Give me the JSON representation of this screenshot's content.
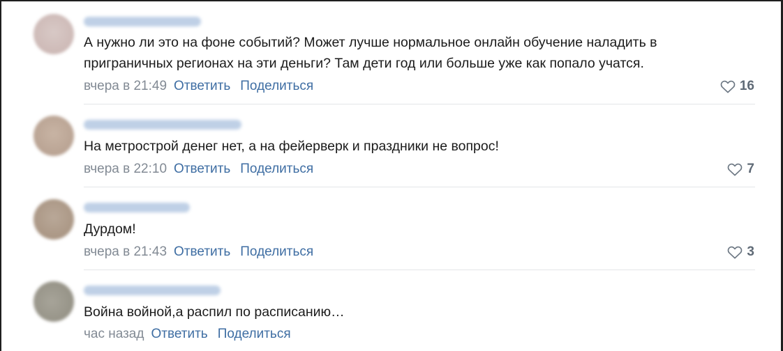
{
  "comments": [
    {
      "text": "А нужно ли это на фоне событий? Может лучше нормальное онлайн обучение наладить в приграничных регионах на эти деньги? Там дети год или больше уже как попало учатся.",
      "time": "вчера в 21:49",
      "reply": "Ответить",
      "share": "Поделиться",
      "likes": "16"
    },
    {
      "text": "На метрострой денег нет, а на фейерверк и праздники не вопрос!",
      "time": "вчера в 22:10",
      "reply": "Ответить",
      "share": "Поделиться",
      "likes": "7"
    },
    {
      "text": "Дурдом!",
      "time": "вчера в 21:43",
      "reply": "Ответить",
      "share": "Поделиться",
      "likes": "3"
    },
    {
      "text": "Война войной,а распил по расписанию…",
      "time": "час назад",
      "reply": "Ответить",
      "share": "Поделиться"
    }
  ],
  "colors": {
    "link": "#3f6ea3",
    "time": "#828a94",
    "text": "#1b1b1b",
    "separator": "#e3e5e8"
  },
  "icons": {
    "like": "heart-icon"
  }
}
